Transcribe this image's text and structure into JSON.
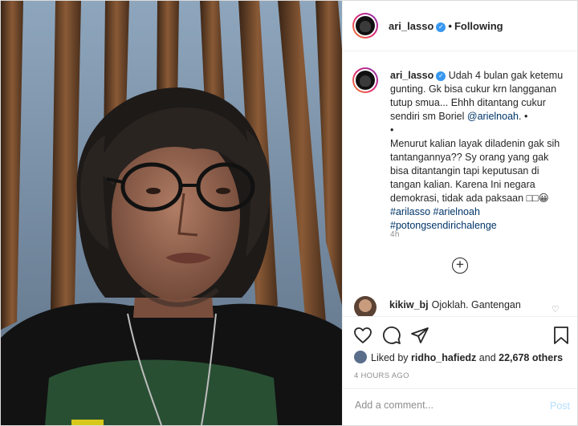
{
  "post": {
    "username": "ari_lasso",
    "following_label": "Following",
    "separator": "•",
    "verified_glyph": "✓"
  },
  "caption": {
    "username": "ari_lasso",
    "text_1": "Udah 4 bulan gak ketemu gunting. Gk bisa cukur krn langganan tutup smua... Ehhh ditantang cukur sendiri sm Boriel",
    "mention": "@arielnoah",
    "text_2": ". •",
    "bullet": "•",
    "text_3": "Menurut kalian layak diladenin gak sih tantangannya?? Sy orang yang gak bisa ditantangin tapi keputusan di tangan kalian. Karena Ini negara demokrasi, tidak ada paksaan",
    "emoji": "□□😀",
    "hashtag_1": "#arilasso",
    "hashtag_2": "#arielnoah",
    "hashtag_3": "#potongsendirichalenge",
    "time": "4h"
  },
  "load_more_glyph": "+",
  "comment": {
    "username": "kikiw_bj",
    "text": "Ojoklah. Gantengan"
  },
  "icons": {
    "like": "heart-icon",
    "comment": "comment-icon",
    "share": "share-icon",
    "save": "bookmark-icon"
  },
  "likes": {
    "prefix": "Liked by",
    "user": "ridho_hafiedz",
    "and": "and",
    "count": "22,678 others"
  },
  "timestamp": "4 HOURS AGO",
  "add_comment": {
    "placeholder": "Add a comment...",
    "post_label": "Post"
  },
  "colors": {
    "link": "#003569",
    "verified": "#3897f0",
    "post_disabled": "#b2dffc",
    "muted": "#8e8e8e"
  }
}
